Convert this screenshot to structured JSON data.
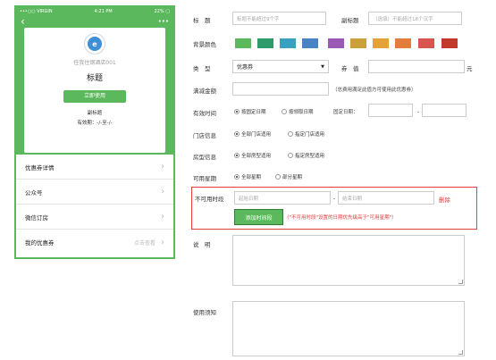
{
  "preview": {
    "status_bar": {
      "carrier": "•••○○ VIRGIN",
      "time": "4:21 PM",
      "battery": "22% ▢"
    },
    "nav": {
      "back_icon": "chevron-left-icon",
      "more_icon": "more-icon",
      "back_glyph": "‹",
      "more_glyph": "•••"
    },
    "logo_text": "e",
    "hotel_name": "任我住钢酒店001",
    "coupon_title": "标题",
    "use_button": "立即使用",
    "subtitle": "副标题",
    "validity": "有效期：-/-至-/-",
    "menu": [
      {
        "label": "优惠券详情",
        "hint": ""
      },
      {
        "label": "公众号",
        "hint": ""
      },
      {
        "label": "微信订房",
        "hint": ""
      },
      {
        "label": "我的优惠券",
        "hint": "点击查看"
      }
    ],
    "accent": "#5cb85c"
  },
  "form": {
    "title_label": "标　题",
    "title_placeholder": "标题不能超过9个字",
    "subtitle_label": "副标题",
    "subtitle_placeholder": "（选填）不能超过18个汉字",
    "bg_color_label": "背景颜色",
    "colors": [
      "#5cb85c",
      "#2e9a6b",
      "#3aa0c0",
      "#4a82c8",
      "#9b59b6",
      "#c9a03a",
      "#e6a23a",
      "#e57d3a",
      "#d9534f",
      "#c0392b"
    ],
    "type_label": "类　型",
    "type_value": "优惠券",
    "amount_label": "券　值",
    "amount_unit": "元",
    "min_label": "满减金额",
    "min_note": "（总费用满足此值方可使用此优惠券）",
    "valid_label": "有效时间",
    "valid_options": [
      "按固定日期",
      "按领取日期"
    ],
    "fixed_date_label": "固定日期：",
    "date_sep": "-",
    "store_label": "门店信息",
    "store_options": [
      "全部门店适用",
      "指定门店适用"
    ],
    "room_label": "房型信息",
    "room_options": [
      "全部房型适用",
      "指定房型适用"
    ],
    "week_label": "可用星期",
    "week_options": [
      "全部星期",
      "部分星期"
    ],
    "unavail_label": "不可用时段",
    "start_placeholder": "起始日期",
    "end_placeholder": "结束日期",
    "delete_link": "删除",
    "add_period_button": "添加时间段",
    "unavail_note": "（\"不可用时段\"设置的日期优先级高于\"可用星期\"）",
    "desc_label": "说　明",
    "notice_label": "使用须知"
  }
}
